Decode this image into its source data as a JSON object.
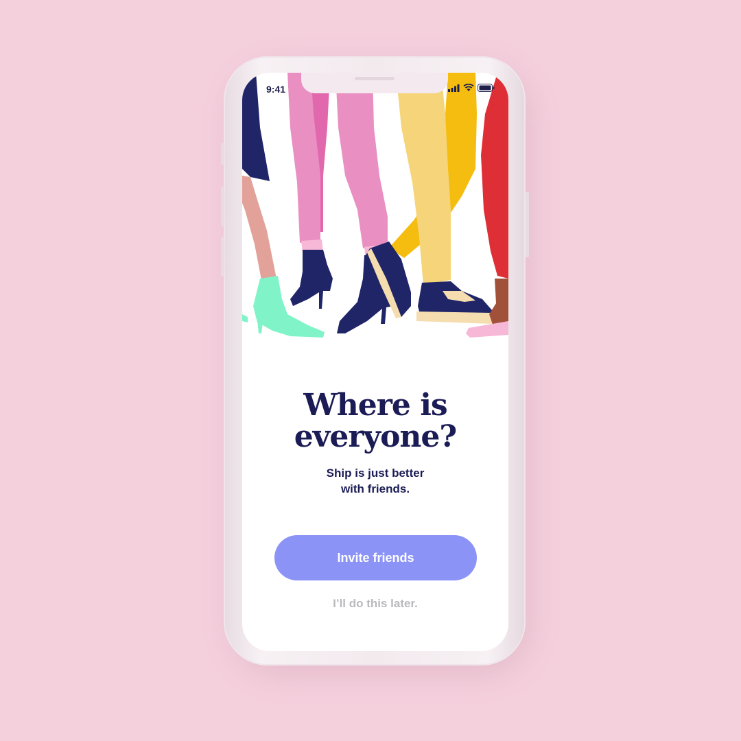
{
  "status_bar": {
    "time": "9:41"
  },
  "onboarding": {
    "title_line1": "Where is",
    "title_line2": "everyone?",
    "subtitle_line1": "Ship is just better",
    "subtitle_line2": "with friends.",
    "invite_button_label": "Invite friends",
    "skip_link_label": "I’ll do this later."
  },
  "colors": {
    "background": "#f4cfdc",
    "title": "#1b1c55",
    "invite_button": "#8c93f7",
    "skip_link": "#b9b9be"
  },
  "icons": [
    "signal-icon",
    "wifi-icon",
    "battery-icon"
  ]
}
